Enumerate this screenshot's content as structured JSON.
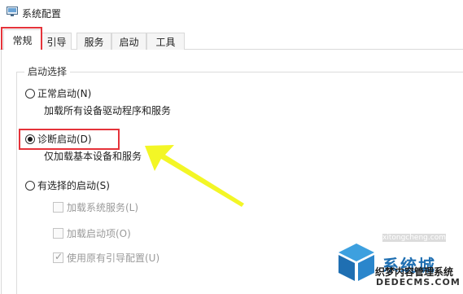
{
  "window": {
    "title": "系统配置",
    "icon": "msconfig-icon"
  },
  "tabs": [
    {
      "label": "常规",
      "active": true
    },
    {
      "label": "引导",
      "active": false
    },
    {
      "label": "服务",
      "active": false
    },
    {
      "label": "启动",
      "active": false
    },
    {
      "label": "工具",
      "active": false
    }
  ],
  "startup_group": {
    "title": "启动选择",
    "options": [
      {
        "label": "正常启动(N)",
        "description": "加载所有设备驱动程序和服务",
        "selected": false
      },
      {
        "label": "诊断启动(D)",
        "description": "仅加载基本设备和服务",
        "selected": true
      },
      {
        "label": "有选择的启动(S)",
        "description": "",
        "selected": false
      }
    ],
    "selective_items": [
      {
        "label": "加载系统服务(L)",
        "checked": false,
        "enabled": false
      },
      {
        "label": "加载启动项(O)",
        "checked": false,
        "enabled": false
      },
      {
        "label": "使用原有引导配置(U)",
        "checked": true,
        "enabled": false
      }
    ]
  },
  "annotation": {
    "highlight_color": "#e5333a",
    "arrow_color": "#f2f51a"
  },
  "watermark": {
    "brand": "系统城",
    "url_top": "xitongcheng.com",
    "subtitle": "织梦内容管理系统",
    "url_bottom": "DEDECMS.COM",
    "colors": [
      "#1f6fb2",
      "#3da0df"
    ]
  }
}
